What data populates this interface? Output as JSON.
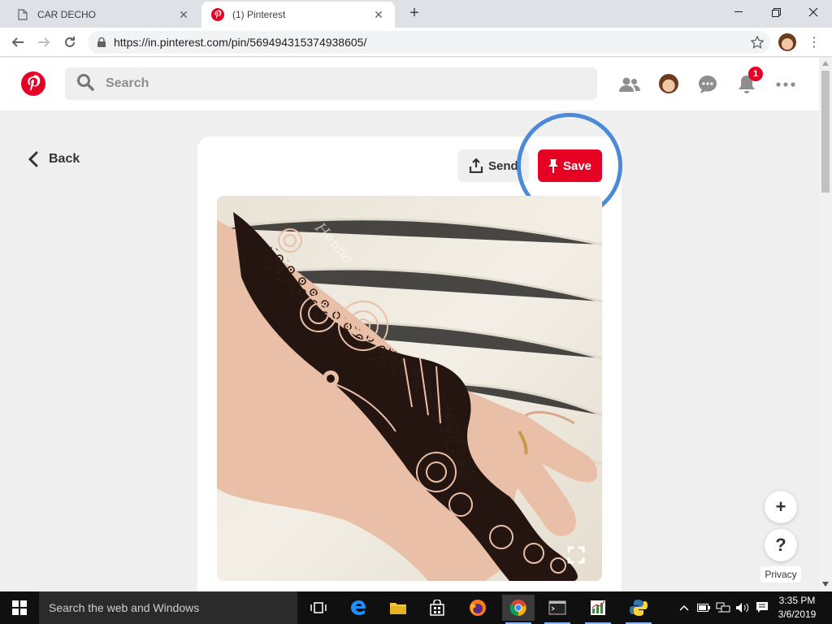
{
  "browser": {
    "tabs": [
      {
        "title": "CAR DECHO",
        "active": false
      },
      {
        "title": "(1) Pinterest",
        "active": true
      }
    ],
    "url": "https://in.pinterest.com/pin/569494315374938605/"
  },
  "header": {
    "search_placeholder": "Search",
    "notification_count": "1"
  },
  "pin": {
    "back_label": "Back",
    "send_label": "Send",
    "save_label": "Save"
  },
  "fab": {
    "add": "+",
    "help": "?",
    "privacy": "Privacy"
  },
  "taskbar": {
    "search_placeholder": "Search the web and Windows",
    "time": "3:35 PM",
    "date": "3/6/2019"
  },
  "colors": {
    "pinterest_red": "#e60023",
    "highlight_ring": "#4a8ad8"
  }
}
